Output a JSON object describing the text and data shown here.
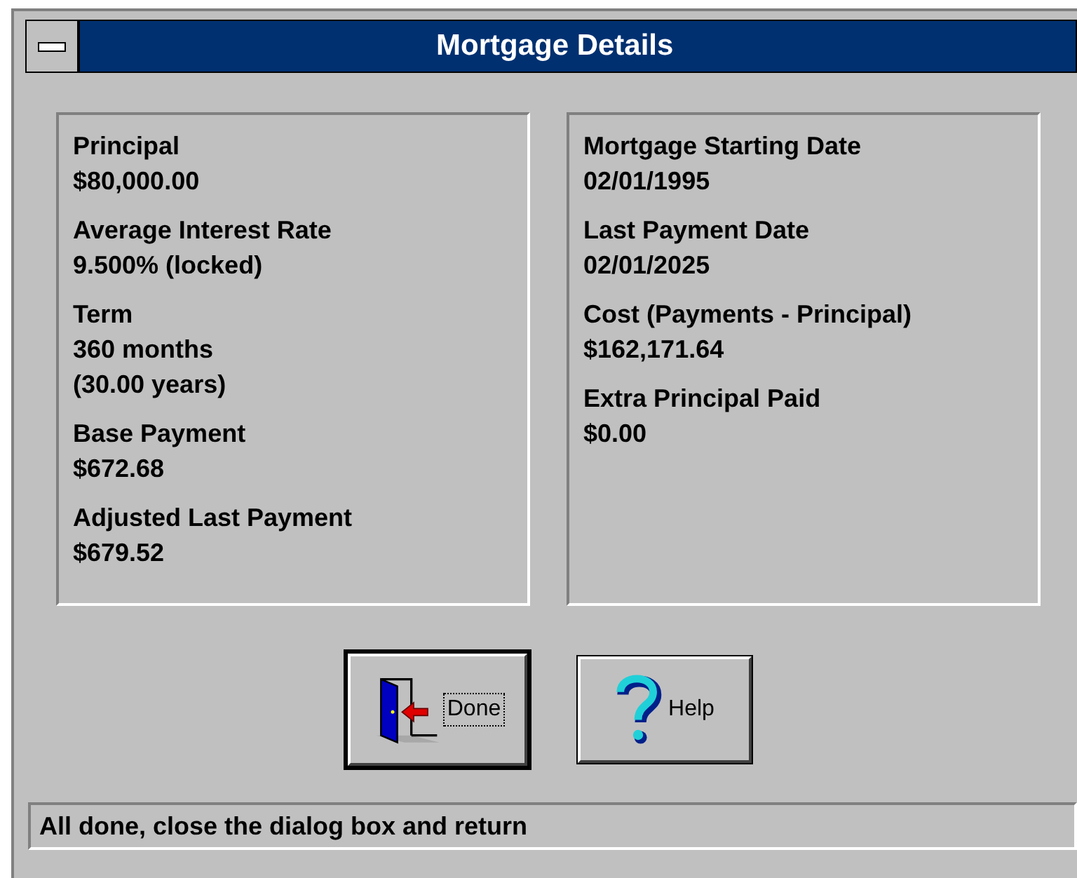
{
  "window": {
    "title": "Mortgage Details"
  },
  "panels": [
    {
      "fields": [
        {
          "label": "Principal",
          "values": [
            "$80,000.00"
          ]
        },
        {
          "label": "Average Interest Rate",
          "values": [
            "9.500% (locked)"
          ]
        },
        {
          "label": "Term",
          "values": [
            "360 months",
            "(30.00 years)"
          ]
        },
        {
          "label": "Base Payment",
          "values": [
            "$672.68"
          ]
        },
        {
          "label": "Adjusted Last Payment",
          "values": [
            "$679.52"
          ]
        }
      ]
    },
    {
      "fields": [
        {
          "label": "Mortgage Starting Date",
          "values": [
            "02/01/1995"
          ]
        },
        {
          "label": "Last Payment Date",
          "values": [
            "02/01/2025"
          ]
        },
        {
          "label": "Cost (Payments - Principal)",
          "values": [
            "$162,171.64"
          ]
        },
        {
          "label": "Extra Principal Paid",
          "values": [
            "$0.00"
          ]
        }
      ]
    }
  ],
  "buttons": [
    {
      "label": "Done",
      "kind": "done",
      "default": true
    },
    {
      "label": "Help",
      "kind": "help",
      "default": false
    }
  ],
  "status_bar": "All done, close the dialog box and return"
}
